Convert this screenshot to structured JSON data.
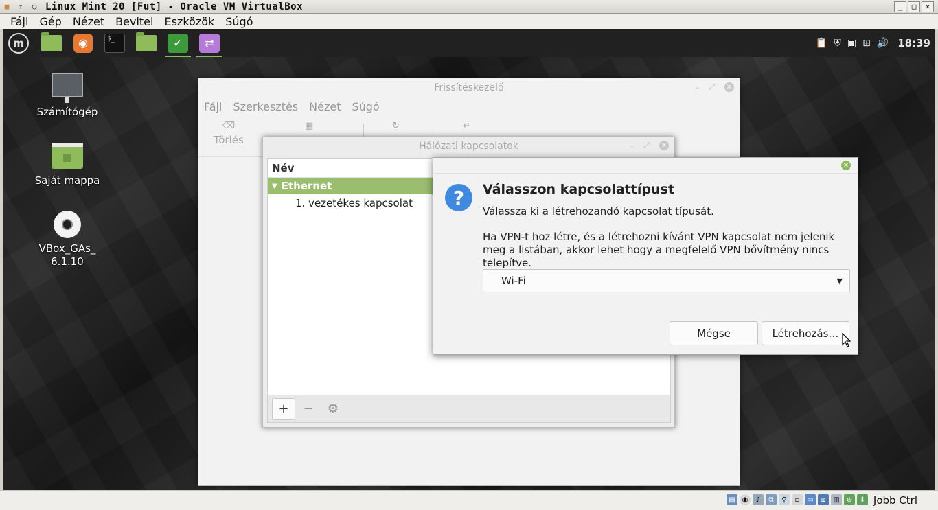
{
  "vbox": {
    "title": "Linux Mint 20 [Fut] - Oracle VM VirtualBox",
    "menu": [
      "Fájl",
      "Gép",
      "Nézet",
      "Bevitel",
      "Eszközök",
      "Súgó"
    ],
    "host_key": "Jobb Ctrl"
  },
  "panel": {
    "clock": "18:39",
    "apps": [
      "files-icon",
      "firefox-icon",
      "terminal-icon",
      "folder-icon",
      "update-manager-icon",
      "network-icon"
    ]
  },
  "desktop": {
    "icons": [
      {
        "label": "Számítógép"
      },
      {
        "label": "Saját mappa"
      },
      {
        "label": "VBox_GAs_\n6.1.10"
      }
    ]
  },
  "update_manager": {
    "title": "Frissítéskezelő",
    "menu": [
      "Fájl",
      "Szerkesztés",
      "Nézet",
      "Súgó"
    ],
    "toolbar": {
      "clear": "Törlés"
    }
  },
  "network_connections": {
    "title": "Hálózati kapcsolatok",
    "column_header": "Név",
    "group": "Ethernet",
    "connections": [
      "1. vezetékes kapcsolat"
    ],
    "buttons": {
      "add": "+",
      "remove": "−",
      "settings": "⚙"
    }
  },
  "dialog": {
    "heading": "Válasszon kapcsolattípust",
    "subtitle": "Válassza ki a létrehozandó kapcsolat típusát.",
    "info": "Ha VPN-t hoz létre, és a létrehozni kívánt VPN kapcsolat nem jelenik meg a listában, akkor lehet hogy a megfelelő VPN bővítmény nincs telepítve.",
    "selected_type": "Wi-Fi",
    "cancel": "Mégse",
    "create": "Létrehozás…"
  },
  "colors": {
    "mint_green": "#9bbd6e",
    "dialog_icon": "#3f8ae0",
    "panel": "#212121"
  }
}
